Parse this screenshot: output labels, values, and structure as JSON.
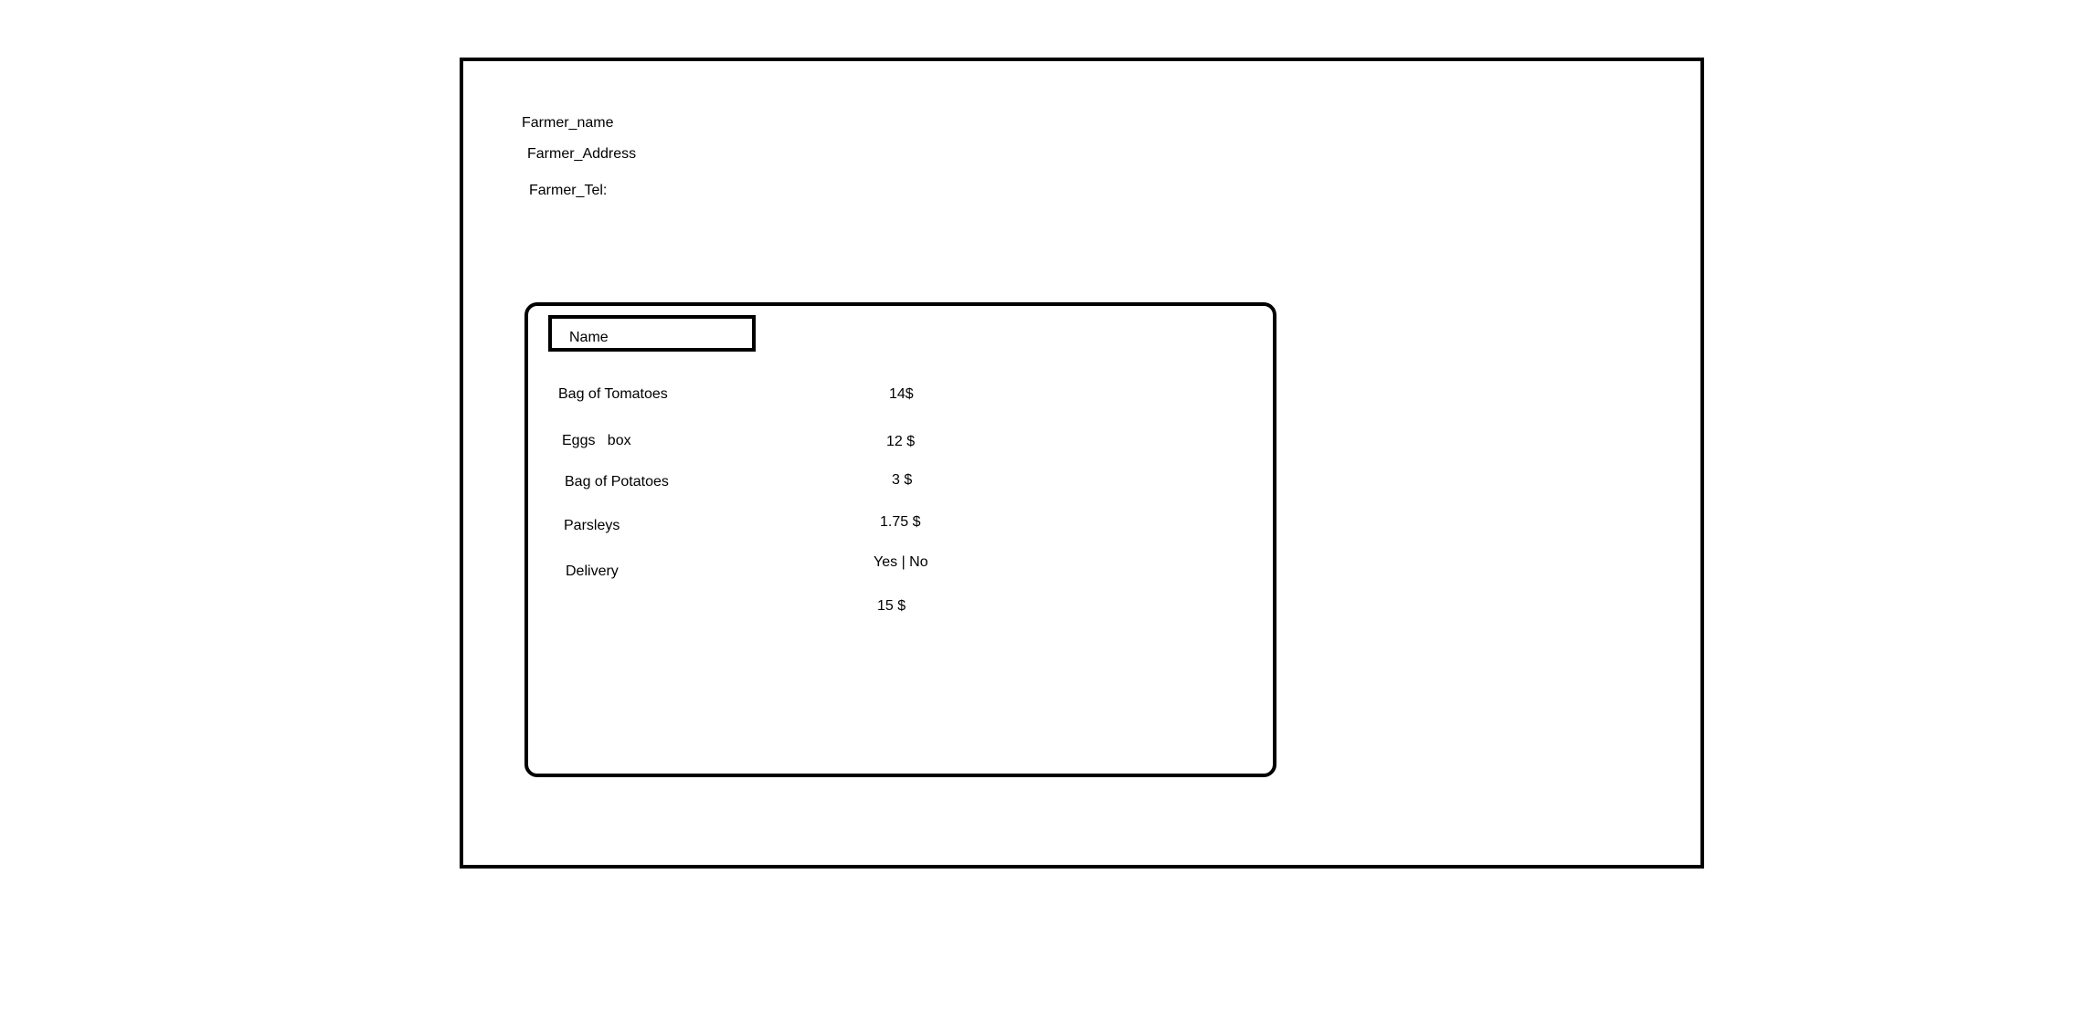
{
  "farmer": {
    "name_label": "Farmer_name",
    "address_label": "Farmer_Address",
    "tel_label": "Farmer_Tel:"
  },
  "order": {
    "name_field": "Name",
    "items": [
      {
        "label": "Bag of Tomatoes",
        "price": "14$"
      },
      {
        "label": "Eggs   box",
        "price": "12 $"
      },
      {
        "label": "Bag of Potatoes",
        "price": "3 $"
      },
      {
        "label": "Parsleys",
        "price": "1.75 $"
      }
    ],
    "delivery": {
      "label": "Delivery",
      "options_yes": "Yes",
      "options_sep": "|",
      "options_no": "No",
      "price": "15 $"
    }
  }
}
